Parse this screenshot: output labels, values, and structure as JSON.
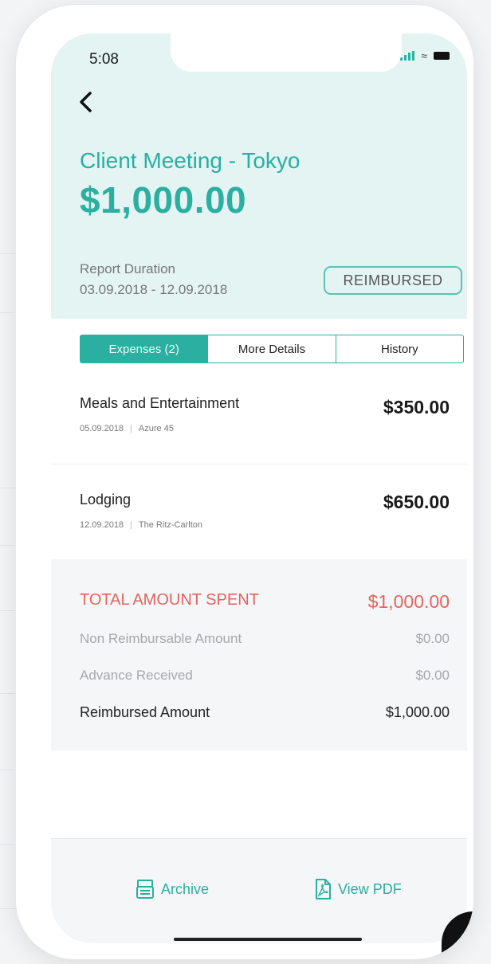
{
  "status_bar": {
    "time": "5:08"
  },
  "header": {
    "title": "Client Meeting - Tokyo",
    "amount": "$1,000.00",
    "duration_label": "Report Duration",
    "duration_value": "03.09.2018 - 12.09.2018",
    "status_badge": "REIMBURSED"
  },
  "tabs": [
    {
      "label": "Expenses (2)",
      "active": true
    },
    {
      "label": "More Details",
      "active": false
    },
    {
      "label": "History",
      "active": false
    }
  ],
  "expenses": [
    {
      "name": "Meals and Entertainment",
      "date": "05.09.2018",
      "vendor": "Azure 45",
      "amount": "$350.00"
    },
    {
      "name": "Lodging",
      "date": "12.09.2018",
      "vendor": "The Ritz-Carlton",
      "amount": "$650.00"
    }
  ],
  "summary": {
    "total_label": "TOTAL AMOUNT SPENT",
    "total_value": "$1,000.00",
    "non_reimb_label": "Non Reimbursable Amount",
    "non_reimb_value": "$0.00",
    "advance_label": "Advance Received",
    "advance_value": "$0.00",
    "reimbursed_label": "Reimbursed Amount",
    "reimbursed_value": "$1,000.00"
  },
  "bottom_bar": {
    "archive_label": "Archive",
    "archive_icon": "archive-icon",
    "pdf_label": "View PDF",
    "pdf_icon": "pdf-icon"
  },
  "colors": {
    "accent": "#2aafa0",
    "header_bg": "#e3f4f3",
    "total_red": "#e2655f"
  }
}
